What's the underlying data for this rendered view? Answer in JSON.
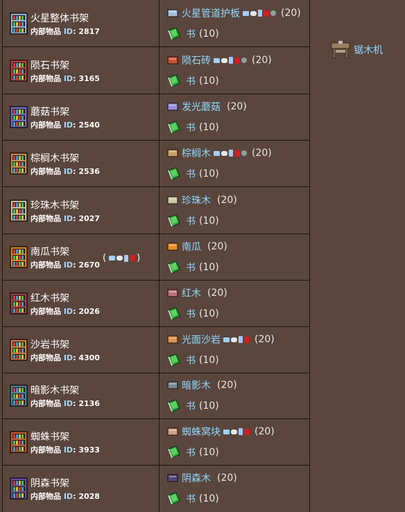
{
  "id_label_prefix": "内部物品 ",
  "id_label_key": "ID",
  "id_label_colon": ":",
  "crafting_station": {
    "name": "锯木机",
    "icon": "sawmill-icon"
  },
  "book": {
    "name": "书",
    "qty": "(10)",
    "icon": "book-icon"
  },
  "rows": [
    {
      "name": "火星整体书架",
      "id": "2817",
      "icon": "martian-bookcase-icon",
      "icon_color": "#8fb0d8",
      "material": "火星管道护板",
      "material_qty": "(20)",
      "material_icon": "martian-conduit-plating-icon",
      "material_color": "#a0c0e0",
      "platforms": [
        "pc",
        "console",
        "mobile",
        "3ds",
        "old-gen"
      ]
    },
    {
      "name": "陨石书架",
      "id": "3165",
      "icon": "meteorite-bookcase-icon",
      "icon_color": "#c04040",
      "material": "陨石砖",
      "material_qty": "(20)",
      "material_icon": "meteorite-brick-icon",
      "material_color": "#d05030",
      "platforms": [
        "pc",
        "console",
        "mobile",
        "3ds",
        "old-gen"
      ]
    },
    {
      "name": "蘑菇书架",
      "id": "2540",
      "icon": "mushroom-bookcase-icon",
      "icon_color": "#7070d0",
      "material": "发光蘑菇",
      "material_qty": "(20)",
      "material_icon": "glowing-mushroom-icon",
      "material_color": "#9090e0",
      "platforms": []
    },
    {
      "name": "棕榈木书架",
      "id": "2536",
      "icon": "palm-wood-bookcase-icon",
      "icon_color": "#c09050",
      "material": "棕榈木",
      "material_qty": "(20)",
      "material_icon": "palm-wood-icon",
      "material_color": "#c8a060",
      "platforms": [
        "pc",
        "console",
        "mobile",
        "3ds",
        "old-gen"
      ]
    },
    {
      "name": "珍珠木书架",
      "id": "2027",
      "icon": "pearlwood-bookcase-icon",
      "icon_color": "#c8c098",
      "material": "珍珠木",
      "material_qty": "(20)",
      "material_icon": "pearlwood-icon",
      "material_color": "#d0c8a0",
      "platforms": []
    },
    {
      "name": "南瓜书架",
      "id": "2670",
      "icon": "pumpkin-bookcase-icon",
      "icon_color": "#e08020",
      "material": "南瓜",
      "material_qty": "(20)",
      "material_icon": "pumpkin-icon",
      "material_color": "#f09020",
      "platforms": [],
      "name_platforms": [
        "pc",
        "console",
        "mobile",
        "3ds"
      ]
    },
    {
      "name": "红木书架",
      "id": "2026",
      "icon": "rich-mahogany-bookcase-icon",
      "icon_color": "#a04050",
      "material": "红木",
      "material_qty": "(20)",
      "material_icon": "rich-mahogany-icon",
      "material_color": "#c07080",
      "platforms": []
    },
    {
      "name": "沙岩书架",
      "id": "4300",
      "icon": "sandstone-bookcase-icon",
      "icon_color": "#d08040",
      "material": "光面沙岩",
      "material_qty": "(20)",
      "material_icon": "smooth-sandstone-icon",
      "material_color": "#e09050",
      "platforms": [
        "pc",
        "console",
        "mobile",
        "3ds"
      ]
    },
    {
      "name": "暗影木书架",
      "id": "2136",
      "icon": "shadewood-bookcase-icon",
      "icon_color": "#5080a0",
      "material": "暗影木",
      "material_qty": "(20)",
      "material_icon": "shadewood-icon",
      "material_color": "#708898",
      "platforms": []
    },
    {
      "name": "蜘蛛书架",
      "id": "3933",
      "icon": "spider-bookcase-icon",
      "icon_color": "#c06030",
      "material": "蜘蛛窝块",
      "material_qty": "(20)",
      "material_icon": "spider-nest-block-icon",
      "material_color": "#d0a080",
      "platforms": [
        "pc",
        "console",
        "mobile",
        "3ds"
      ]
    },
    {
      "name": "阴森书架",
      "id": "2028",
      "icon": "spooky-bookcase-icon",
      "icon_color": "#6050a0",
      "material": "阴森木",
      "material_qty": "(20)",
      "material_icon": "spooky-wood-icon",
      "material_color": "#504880",
      "platforms": []
    }
  ]
}
